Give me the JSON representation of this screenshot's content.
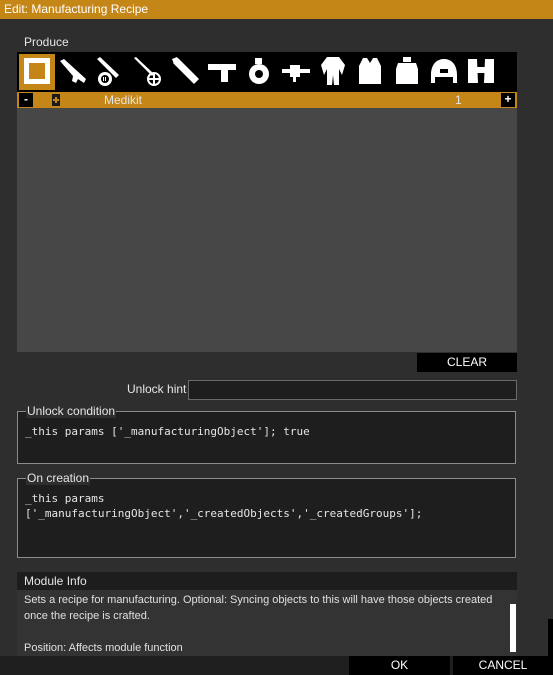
{
  "window": {
    "title": "Edit: Manufacturing Recipe"
  },
  "produce": {
    "label": "Produce",
    "categories": [
      {
        "icon": "crate-icon",
        "active": true
      },
      {
        "icon": "rifle-icon"
      },
      {
        "icon": "machine-gun-icon"
      },
      {
        "icon": "sniper-rifle-icon"
      },
      {
        "icon": "launcher-icon"
      },
      {
        "icon": "pistol-icon"
      },
      {
        "icon": "grenade-icon"
      },
      {
        "icon": "attachment-icon"
      },
      {
        "icon": "uniform-icon"
      },
      {
        "icon": "vest-icon"
      },
      {
        "icon": "backpack-icon"
      },
      {
        "icon": "helmet-icon"
      },
      {
        "icon": "binoculars-icon"
      }
    ],
    "item": {
      "minus": "-",
      "icon": "medikit-icon",
      "name": "Medikit",
      "count": "1",
      "plus": "+"
    },
    "clear_label": "CLEAR"
  },
  "unlock_hint": {
    "label": "Unlock hint",
    "value": ""
  },
  "unlock_condition": {
    "legend": "Unlock condition",
    "code": "_this params ['_manufacturingObject']; true"
  },
  "on_creation": {
    "legend": "On creation",
    "code": "_this params\n['_manufacturingObject','_createdObjects','_createdGroups'];"
  },
  "module_info": {
    "title": "Module Info",
    "text1": "Sets a recipe for manufacturing. Optional: Syncing objects to this will have those objects created once the recipe is crafted.",
    "text2": "Position: Affects module function"
  },
  "footer": {
    "ok_label": "OK",
    "cancel_label": "CANCEL"
  }
}
